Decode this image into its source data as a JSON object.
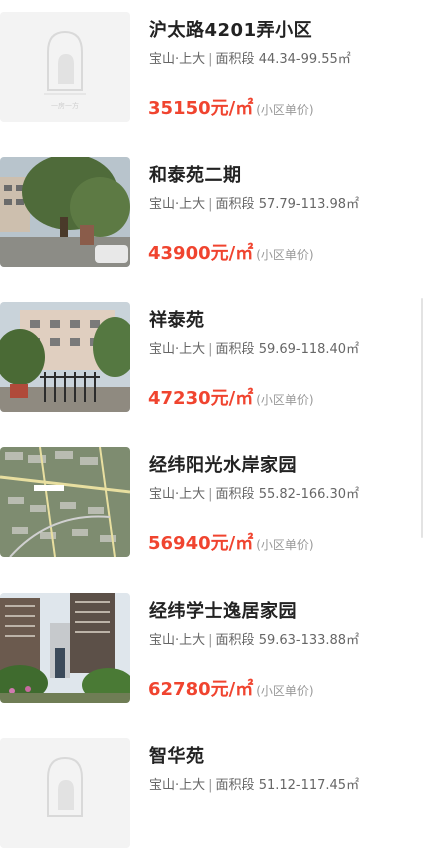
{
  "listings": [
    {
      "title": "沪太路4201弄小区",
      "district": "宝山·上大",
      "area_label": "面积段",
      "area_range": "44.34-99.55㎡",
      "price": "35150元/㎡",
      "price_note": "(小区单价)",
      "image": "placeholder-logo",
      "logo_caption": "一房一方"
    },
    {
      "title": "和泰苑二期",
      "district": "宝山·上大",
      "area_label": "面积段",
      "area_range": "57.79-113.98㎡",
      "price": "43900元/㎡",
      "price_note": "(小区单价)",
      "image": "street-photo"
    },
    {
      "title": "祥泰苑",
      "district": "宝山·上大",
      "area_label": "面积段",
      "area_range": "59.69-118.40㎡",
      "price": "47230元/㎡",
      "price_note": "(小区单价)",
      "image": "gate-photo"
    },
    {
      "title": "经纬阳光水岸家园",
      "district": "宝山·上大",
      "area_label": "面积段",
      "area_range": "55.82-166.30㎡",
      "price": "56940元/㎡",
      "price_note": "(小区单价)",
      "image": "satellite-map"
    },
    {
      "title": "经纬学士逸居家园",
      "district": "宝山·上大",
      "area_label": "面积段",
      "area_range": "59.63-133.88㎡",
      "price": "62780元/㎡",
      "price_note": "(小区单价)",
      "image": "tower-photo"
    },
    {
      "title": "智华苑",
      "district": "宝山·上大",
      "area_label": "面积段",
      "area_range": "51.12-117.45㎡",
      "price": "",
      "price_note": "",
      "image": "placeholder-logo",
      "logo_caption": "一房一方"
    }
  ],
  "colors": {
    "price": "#f0442f",
    "title": "#222222",
    "meta": "#666666",
    "note": "#999999"
  }
}
